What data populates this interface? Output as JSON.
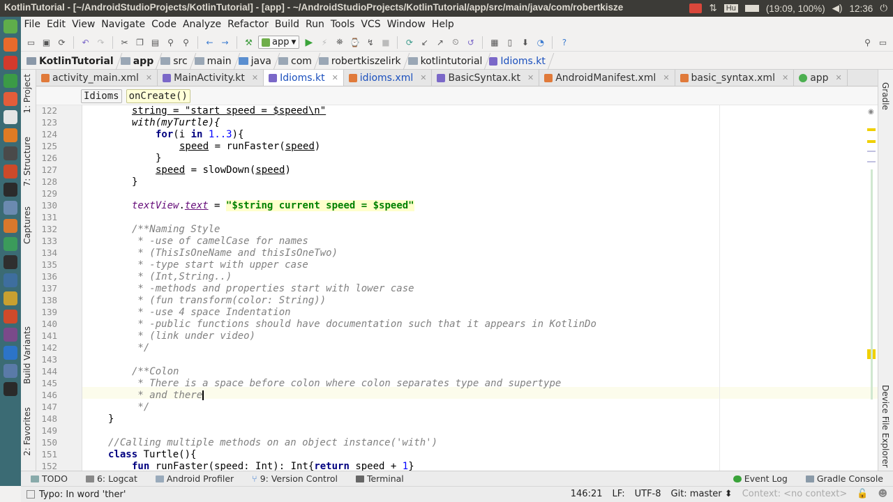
{
  "window": {
    "title": "KotlinTutorial - [~/AndroidStudioProjects/KotlinTutorial] - [app] - ~/AndroidStudioProjects/KotlinTutorial/app/src/main/java/com/robertkisze"
  },
  "tray": {
    "keyboard": "Hu",
    "battery": "(19:09, 100%)",
    "clock": "12:36"
  },
  "menu": [
    "File",
    "Edit",
    "View",
    "Navigate",
    "Code",
    "Analyze",
    "Refactor",
    "Build",
    "Run",
    "Tools",
    "VCS",
    "Window",
    "Help"
  ],
  "toolbar": {
    "run_config": "app"
  },
  "breadcrumbs": [
    "KotlinTutorial",
    "app",
    "src",
    "main",
    "java",
    "com",
    "robertkiszelirk",
    "kotlintutorial",
    "Idioms.kt"
  ],
  "tabs": [
    {
      "label": "activity_main.xml",
      "color": "#e07a3a"
    },
    {
      "label": "MainActivity.kt",
      "color": "#7b68c8"
    },
    {
      "label": "Idioms.kt",
      "color": "#7b68c8"
    },
    {
      "label": "idioms.xml",
      "color": "#e07a3a"
    },
    {
      "label": "BasicSyntax.kt",
      "color": "#7b68c8"
    },
    {
      "label": "AndroidManifest.xml",
      "color": "#e07a3a"
    },
    {
      "label": "basic_syntax.xml",
      "color": "#e07a3a"
    },
    {
      "label": "app",
      "color": "#4caf50"
    }
  ],
  "structure_crumbs": [
    "Idioms",
    "onCreate()"
  ],
  "left_tools": [
    "1: Project",
    "7: Structure",
    "Captures",
    "Build Variants",
    "2: Favorites"
  ],
  "right_tools": [
    "Gradle",
    "Device File Explorer"
  ],
  "line_numbers": [
    "122",
    "123",
    "124",
    "125",
    "126",
    "127",
    "128",
    "129",
    "130",
    "131",
    "132",
    "133",
    "134",
    "135",
    "136",
    "137",
    "138",
    "139",
    "140",
    "141",
    "142",
    "143",
    "144",
    "145",
    "146",
    "147",
    "148",
    "149",
    "150",
    "151",
    "152"
  ],
  "code": {
    "l122": "string = \"start speed = $speed\\n\"",
    "l123": "with(myTurtle){",
    "l124a": "for",
    "l124b": "(i ",
    "l124c": "in",
    "l124d": "1..3",
    "l124e": "){",
    "l125a": "speed",
    "l125b": " = runFaster(",
    "l125c": "speed",
    "l125d": ")",
    "l126": "}",
    "l127a": "speed",
    "l127b": " = slowDown(",
    "l127c": "speed",
    "l127d": ")",
    "l128": "}",
    "l130a": "textView",
    "l130b": ".",
    "l130c": "text",
    "l130d": " = ",
    "l130e": "\"$string current speed = $speed\"",
    "l132": "/**Naming Style",
    "l133": " * -use of camelCase for names",
    "l134": " * (ThisIsOneName and thisIsOneTwo)",
    "l135": " * -type start with upper case",
    "l136": " * (Int,String..)",
    "l137": " * -methods and properties start with lower case",
    "l138": " * (fun transform(color: String))",
    "l139": " * -use 4 space Indentation",
    "l140": " * -public functions should have documentation such that it appears in KotlinDo",
    "l141": " * (link under video)",
    "l142": " */",
    "l144": "/**Colon",
    "l145": " * There is a space before colon where colon separates type and supertype",
    "l146": " * and there",
    "l147": " */",
    "l148": "}",
    "l150": "//Calling multiple methods on an object instance('with')",
    "l151a": "class",
    "l151b": " Turtle(){",
    "l152a": "fun",
    "l152b": " runFaster(speed: Int): Int{",
    "l152c": "return",
    "l152d": " speed + ",
    "l152e": "1",
    "l152f": "}"
  },
  "bottom_tools": [
    "TODO",
    "6: Logcat",
    "Android Profiler",
    "9: Version Control",
    "Terminal"
  ],
  "bottom_tools_right": [
    "Event Log",
    "Gradle Console"
  ],
  "status": {
    "message": "Typo: In word 'ther'",
    "position": "146:21",
    "line_sep": "LF:",
    "encoding": "UTF-8",
    "git": "Git: master",
    "context": "Context: <no context>"
  }
}
